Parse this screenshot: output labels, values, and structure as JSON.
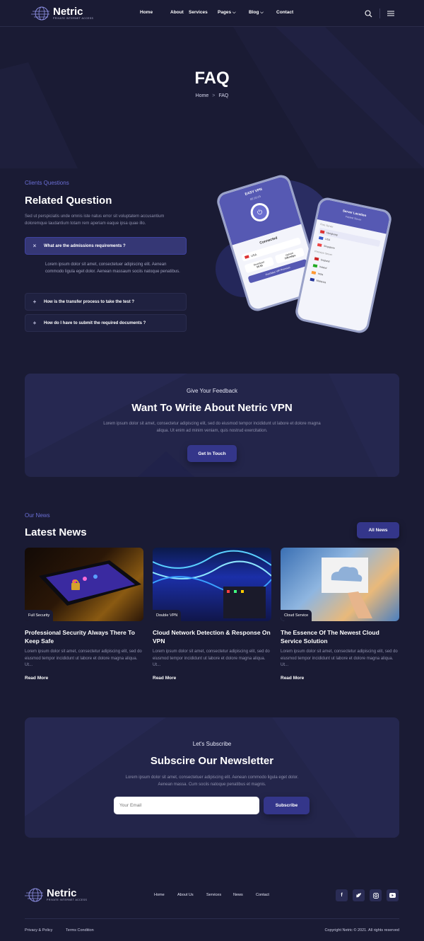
{
  "brand": {
    "name": "Netric",
    "tagline": "PRIVATE INTERNET ACCESS"
  },
  "nav": {
    "items": [
      "Home",
      "About",
      "Services",
      "Pages",
      "Blog",
      "Contact"
    ],
    "dropdown_items": [
      "Pages",
      "Blog"
    ]
  },
  "hero": {
    "title": "FAQ",
    "breadcrumb_home": "Home",
    "breadcrumb_sep": ">",
    "breadcrumb_current": "FAQ"
  },
  "faq": {
    "eyebrow": "Clients Questions",
    "title": "Related Question",
    "intro": "Sed ut perspiciatis unde omnis iste natus error sit voluptatem accusantium doloremque laudantium totam rem aperiam eaque ipsa quae illo.",
    "items": [
      {
        "question": "What are the admissions requirements ?",
        "sign": "×",
        "open": true,
        "answer": "Lorem ipsum dolor sit amet, consectetuer adipiscing elit. Aenean commodo ligula eget dolor. Aenean massaum sociis natoque penatibus."
      },
      {
        "question": "How is the transfer process to take the test ?",
        "sign": "+",
        "open": false
      },
      {
        "question": "How do I have to submit the required documents ?",
        "sign": "+",
        "open": false
      }
    ]
  },
  "phone_a": {
    "app_title": "EASY VPN",
    "timer": "00:10:15",
    "status": "Connected",
    "country": "USA",
    "download_label": "Download",
    "download_value": "50.55",
    "upload_label": "Upload",
    "upload_value": "108.mbps",
    "premium": "Purchase VIP Premium"
  },
  "phone_b": {
    "title": "Server Location",
    "subtitle": "Fastest Server",
    "free_label": "Free Server",
    "premium_label": "Premium Server",
    "servers": [
      "Hongkong",
      "USA",
      "Singapore",
      "England",
      "Ireland",
      "India",
      "Malaysia"
    ]
  },
  "feedback": {
    "eyebrow": "Give Your Feedback",
    "title": "Want To Write About Netric VPN",
    "text": "Lorem ipsum dolor sit amet, consectetur adipiscing elit, sed do eiusmod tempor incididunt ut labore et dolore magna aliqua. Ut enim ad minim veniam, quis nostrud exercitation.",
    "button": "Get In Touch"
  },
  "news": {
    "eyebrow": "Our News",
    "title": "Latest News",
    "all_button": "All News",
    "read_more": "Read More",
    "cards": [
      {
        "tag": "Full Security",
        "title": "Professional Security Always There To Keep Safe",
        "desc": "Lorem ipsum dolor sit amet, consectetur adipiscing elit, sed do eiusmod tempor incididunt ut labore et dolore magna aliqua. Ut..."
      },
      {
        "tag": "Double VPN",
        "title": "Cloud Network Detection & Response On VPN",
        "desc": "Lorem ipsum dolor sit amet, consectetur adipiscing elit, sed do eiusmod tempor incididunt ut labore et dolore magna aliqua. Ut..."
      },
      {
        "tag": "Cloud Service",
        "title": "The Essence Of The Newest Cloud Service Solution",
        "desc": "Lorem ipsum dolor sit amet, consectetur adipiscing elit, sed do eiusmod tempor incididunt ut labore et dolore magna aliqua. Ut..."
      }
    ]
  },
  "newsletter": {
    "eyebrow": "Let's Subscribe",
    "title": "Subscire Our Newsletter",
    "text": "Lorem ipsum dolor sit amet, consectetuer adipiscing elit. Aenean commodo ligula eget dolor. Aenean massa. Cum sociis natoque penatibus et magnis.",
    "placeholder": "Your Email",
    "button": "Subscribe"
  },
  "footer": {
    "nav": [
      "Home",
      "About Us",
      "Services",
      "News",
      "Contact"
    ],
    "social": [
      "facebook-icon",
      "twitter-icon",
      "instagram-icon",
      "youtube-icon"
    ],
    "privacy": "Privacy & Policy",
    "terms": "Terms Condition",
    "copyright": "Copyright Netric © 2021. All rights reserved"
  },
  "colors": {
    "background": "#1a1b34",
    "accent": "#6b6fd6",
    "button": "#34368a"
  }
}
